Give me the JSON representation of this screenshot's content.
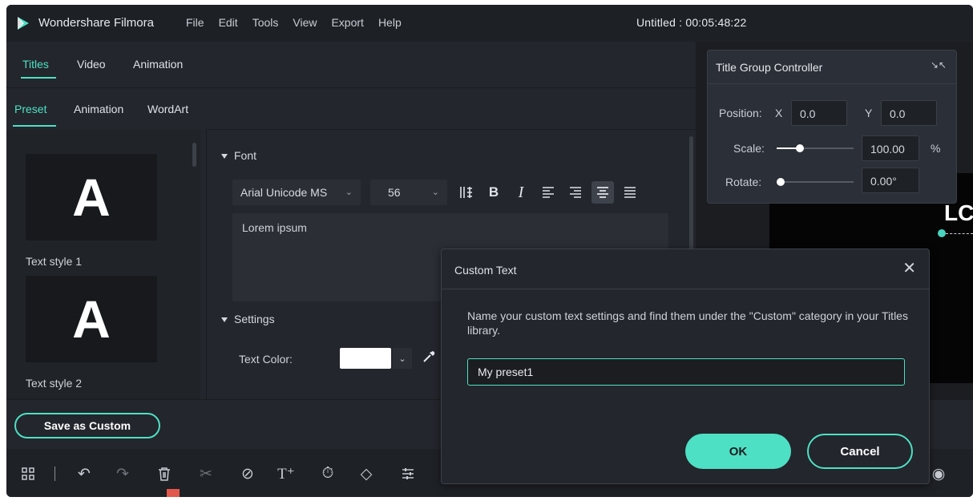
{
  "app": {
    "name": "Wondershare Filmora",
    "window_title": "Untitled : 00:05:48:22",
    "menu": [
      "File",
      "Edit",
      "Tools",
      "View",
      "Export",
      "Help"
    ],
    "accent_color": "#4ee0c4"
  },
  "tabs": {
    "items": [
      "Titles",
      "Video",
      "Animation"
    ],
    "active": "Titles"
  },
  "sub_tabs": {
    "items": [
      "Preset",
      "Animation",
      "WordArt"
    ],
    "active": "Preset"
  },
  "presets": [
    {
      "thumb_glyph": "A",
      "label": "Text style 1"
    },
    {
      "thumb_glyph": "A",
      "label": "Text style 2"
    }
  ],
  "font_section": {
    "header": "Font",
    "font_family": "Arial Unicode MS",
    "font_size": "56",
    "format_buttons": [
      "line-spacing-icon",
      "bold-icon",
      "italic-icon",
      "align-left-icon",
      "align-right-icon",
      "align-center-icon",
      "justify-icon"
    ],
    "selected_format": "align-center-icon",
    "text": "Lorem ipsum"
  },
  "settings_section": {
    "header": "Settings",
    "text_color_label": "Text Color:",
    "text_color": "#ffffff"
  },
  "preview": {
    "visible_text": "LC"
  },
  "title_group_controller": {
    "title": "Title Group Controller",
    "position_label": "Position:",
    "x_label": "X",
    "x_value": "0.0",
    "y_label": "Y",
    "y_value": "0.0",
    "scale_label": "Scale:",
    "scale_value": "100.00",
    "scale_unit": "%",
    "scale_level": 0.3,
    "rotate_label": "Rotate:",
    "rotate_value": "0.00°",
    "rotate_level": 0.0
  },
  "save_button": "Save as Custom",
  "toolbar": {
    "icons": [
      "layout-icon",
      "undo-icon",
      "redo-icon",
      "delete-icon",
      "cut-icon",
      "no-icon",
      "text-add-icon",
      "timer-icon",
      "keyframe-icon",
      "adjust-icon"
    ]
  },
  "dialog": {
    "title": "Custom Text",
    "message": "Name your custom text settings and find them under the \"Custom\" category in your Titles library.",
    "input_value": "My preset1",
    "ok_label": "OK",
    "cancel_label": "Cancel"
  }
}
